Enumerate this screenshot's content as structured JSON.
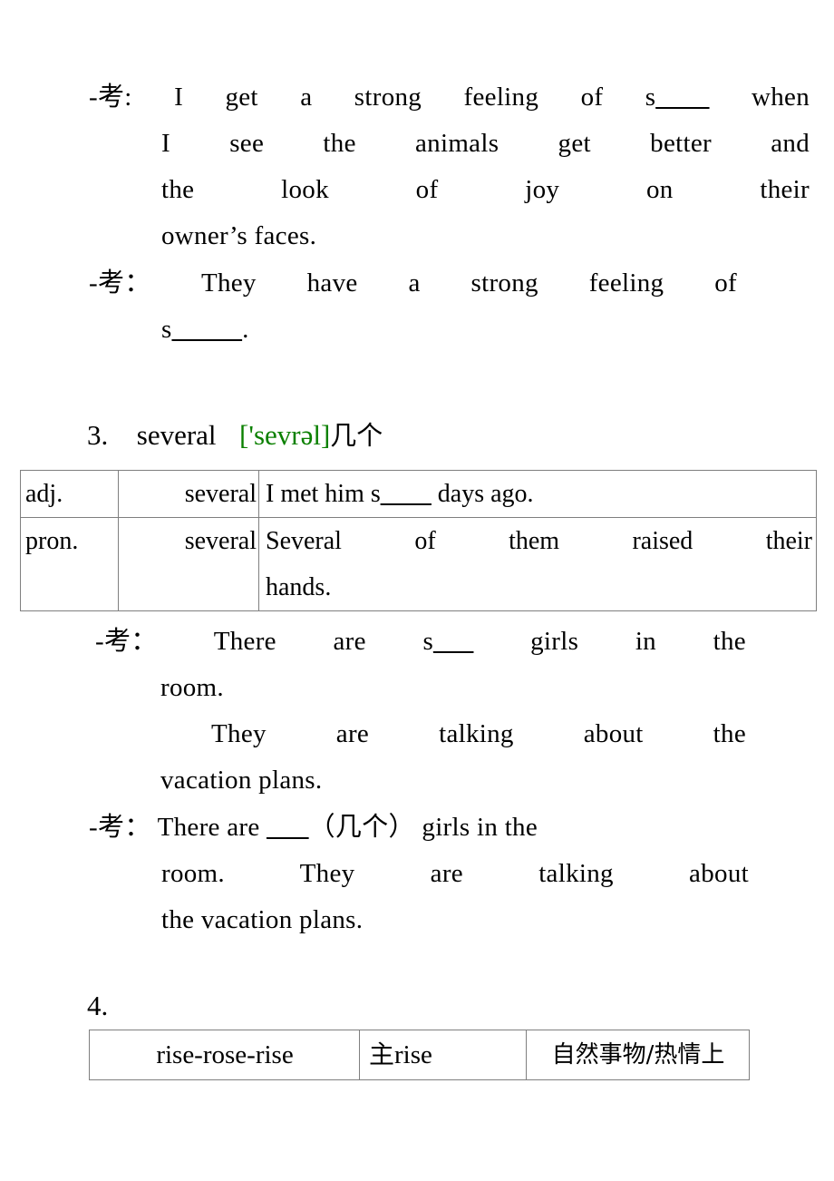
{
  "document": {
    "blocks": {
      "note1": {
        "marker": "-考:",
        "lines": [
          "I get a strong feeling of s",
          "when",
          "I see the animals get better and",
          "the look of joy on their",
          "owner’s faces."
        ],
        "line1_pre": "I get a strong feeling of s",
        "line1_blank": "____",
        "line1_post": "when",
        "line2": "I see the animals get better and",
        "line3": "the look of joy on their",
        "line4": "owner’s faces."
      },
      "note2": {
        "marker": "-考：",
        "line1": "They have a strong feeling of",
        "line2_pre": "s",
        "line2_blank": "_____",
        "line2_post": "."
      },
      "entry3": {
        "number": "3.",
        "word": "several",
        "phonetic": "['sevrəl]",
        "meaning": "几个",
        "phonetic_color": "#0b8000"
      },
      "several_table": {
        "rows": [
          {
            "pos": "adj.",
            "word": "several",
            "example_pre": "I met him s",
            "example_blank": "____",
            "example_post": "days ago.",
            "example_full": "I met him s____ days ago."
          },
          {
            "pos": "pron.",
            "word": "several",
            "example_line1": "Several of them raised their",
            "example_line2": "hands.",
            "example_full": "Several of them raised their hands."
          }
        ]
      },
      "note3": {
        "marker": "-考：",
        "line1_pre": "There are s",
        "line1_blank": "___",
        "line1_post": "girls in the",
        "line2": "room.",
        "line3": "They are talking about the",
        "line4": "vacation plans."
      },
      "note4": {
        "marker": "-考：",
        "line1_blank": "___",
        "line1_pre": "There are",
        "line1_cn": "（几个）",
        "line1_post": "girls in the",
        "line2": "room. They are talking about",
        "line3": "the vacation plans."
      },
      "entry4": {
        "number": "4."
      },
      "rise_table": {
        "cells": {
          "forms": "rise-rose-rise",
          "usage_cn": "主",
          "usage_en": "rise",
          "note_cn": "自然事物/热情上"
        }
      }
    }
  }
}
